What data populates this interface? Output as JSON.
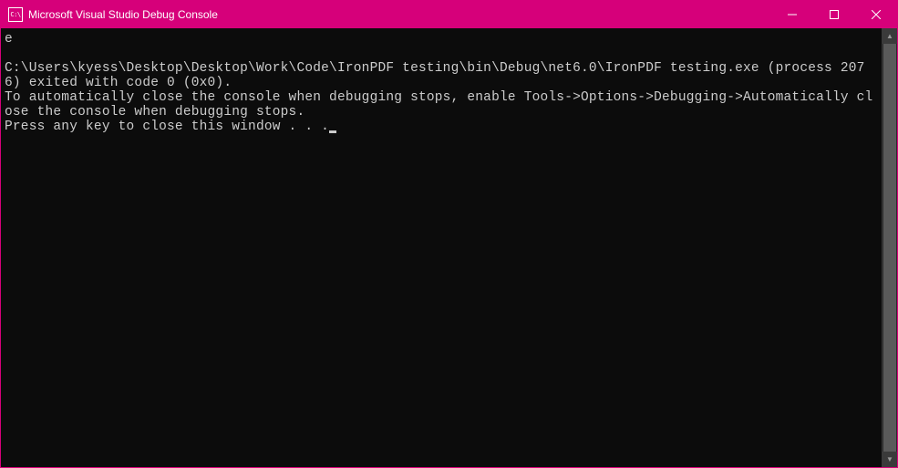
{
  "window": {
    "title": "Microsoft Visual Studio Debug Console",
    "icon_text": "C:\\"
  },
  "console": {
    "line1": "e",
    "line2": "",
    "line3": "C:\\Users\\kyess\\Desktop\\Desktop\\Work\\Code\\IronPDF testing\\bin\\Debug\\net6.0\\IronPDF testing.exe (process 2076) exited with code 0 (0x0).",
    "line4": "To automatically close the console when debugging stops, enable Tools->Options->Debugging->Automatically close the console when debugging stops.",
    "line5": "Press any key to close this window . . ."
  },
  "scrollbar": {
    "up": "▲",
    "down": "▼"
  }
}
